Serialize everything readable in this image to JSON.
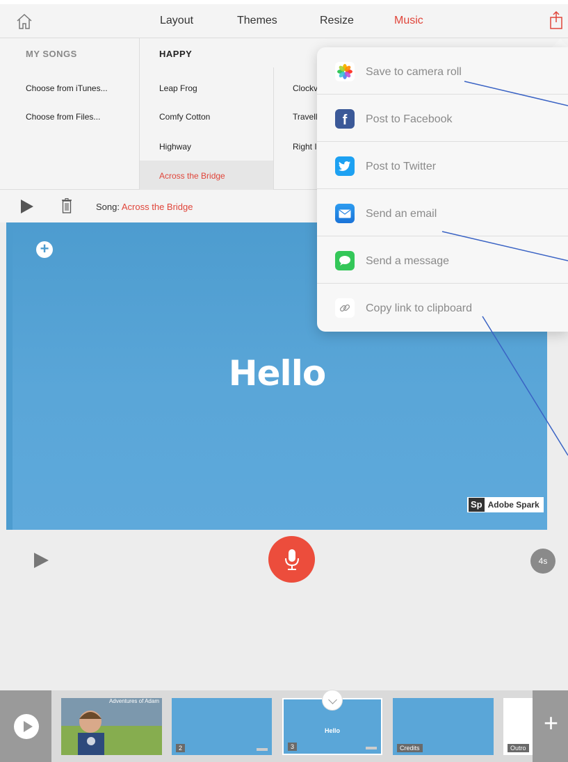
{
  "topnav": {
    "tabs": [
      {
        "label": "Layout"
      },
      {
        "label": "Themes"
      },
      {
        "label": "Resize"
      },
      {
        "label": "Music"
      }
    ]
  },
  "music": {
    "my_songs_header": "MY SONGS",
    "my_songs": [
      "Choose from iTunes...",
      "Choose from Files..."
    ],
    "category_header": "HAPPY",
    "songs_col1": [
      "Leap Frog",
      "Comfy Cotton",
      "Highway",
      "Across the Bridge"
    ],
    "songs_col2": [
      "Clockv",
      "Travell",
      "Right I"
    ]
  },
  "songbar": {
    "label": "Song:",
    "value": "Across the Bridge"
  },
  "canvas": {
    "headline": "Hello",
    "badge_logo": "Sp",
    "badge_text": "Adobe Spark"
  },
  "controls": {
    "duration": "4s"
  },
  "filmstrip": {
    "thumbs": [
      {
        "label": "",
        "title": "Adventures of Adam"
      },
      {
        "label": "2"
      },
      {
        "label": "3",
        "text": "Hello"
      },
      {
        "label": "Credits"
      },
      {
        "label": "Outro"
      }
    ],
    "add_symbol": "+"
  },
  "share_menu": {
    "items": [
      {
        "label": "Save to camera roll",
        "icon": "photos-icon"
      },
      {
        "label": "Post to Facebook",
        "icon": "facebook-icon"
      },
      {
        "label": "Post to Twitter",
        "icon": "twitter-icon"
      },
      {
        "label": "Send an email",
        "icon": "mail-icon"
      },
      {
        "label": "Send a message",
        "icon": "messages-icon"
      },
      {
        "label": "Copy link to clipboard",
        "icon": "link-icon"
      }
    ]
  },
  "colors": {
    "accent": "#e0453a",
    "canvas_blue": "#5aa6d8",
    "facebook": "#3b5998",
    "twitter": "#1da1f2",
    "messages": "#34c759",
    "annotation_line": "#3a63c4"
  }
}
